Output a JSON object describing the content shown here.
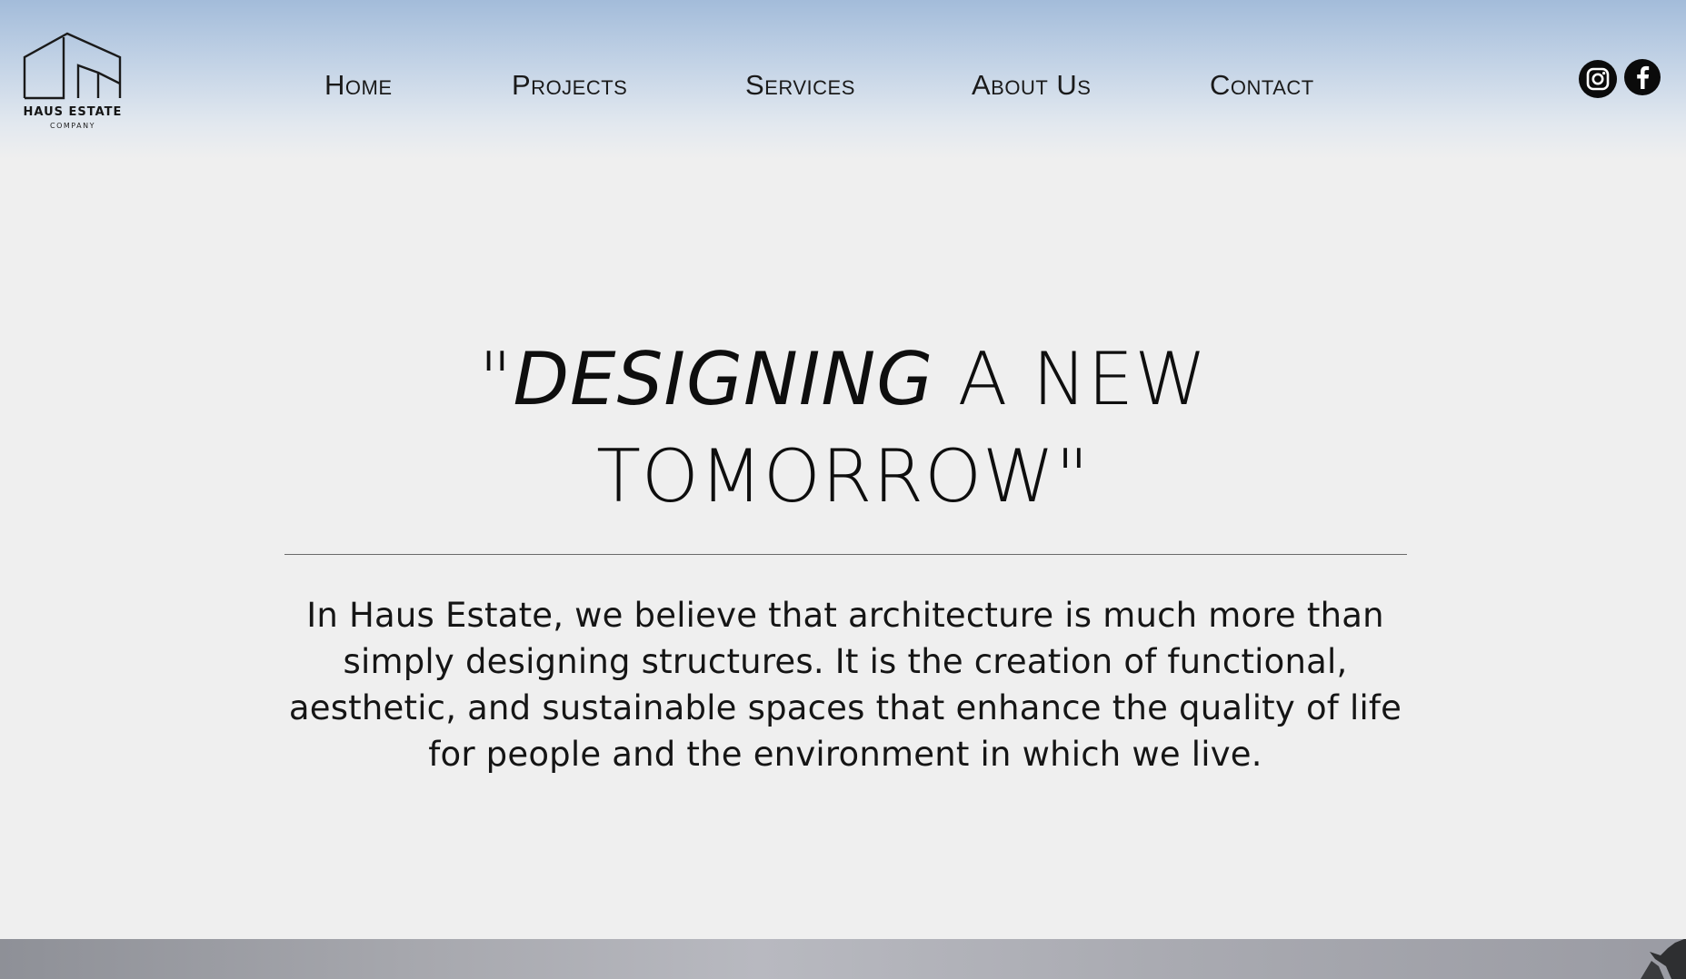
{
  "brand": {
    "name": "HAUS ESTATE",
    "sub": "COMPANY"
  },
  "nav": {
    "items": [
      {
        "label": "Home"
      },
      {
        "label": "Projects"
      },
      {
        "label": "Services"
      },
      {
        "label": "About Us"
      },
      {
        "label": "Contact"
      }
    ]
  },
  "social": {
    "icons": [
      "instagram-icon",
      "facebook-icon"
    ]
  },
  "hero": {
    "quote_open": "\"",
    "quote_em": "DESIGNING",
    "quote_rest_line1": " A NEW",
    "quote_line2": "TOMORROW\"",
    "intro_lines": [
      "In Haus Estate, we believe that architecture is much more than",
      "simply designing structures. It is the creation of functional,",
      "aesthetic, and sustainable spaces that enhance the quality of life",
      "for people and the environment in which we live."
    ]
  },
  "colors": {
    "header_top": "#a3bcda",
    "background": "#efefef",
    "text": "#111111"
  }
}
